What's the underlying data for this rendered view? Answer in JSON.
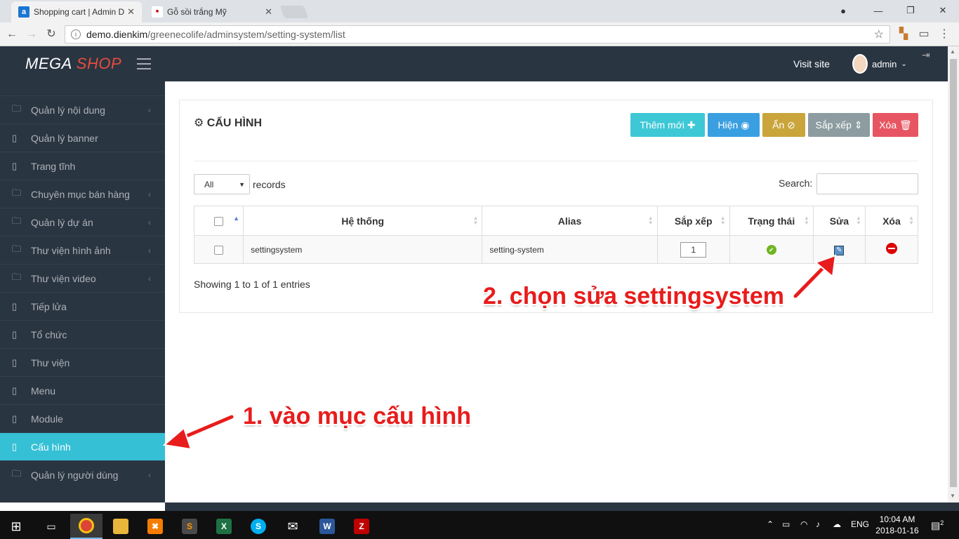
{
  "browser": {
    "tabs": [
      {
        "title": "Shopping cart | Admin D",
        "active": true
      },
      {
        "title": "Gỗ sồi trắng Mỹ",
        "active": false
      }
    ],
    "url_host": "demo.dienkim",
    "url_path": "/greenecolife/adminsystem/setting-system/list"
  },
  "header": {
    "logo_part1": "MEGA",
    "logo_part2": "SHOP",
    "visit_site": "Visit site",
    "user": "admin"
  },
  "sidebar": {
    "items": [
      {
        "label": "Quản lý nội dung",
        "icon": "folder-icon",
        "has_children": true
      },
      {
        "label": "Quản lý banner",
        "icon": "book-icon",
        "has_children": false
      },
      {
        "label": "Trang tĩnh",
        "icon": "book-icon",
        "has_children": false
      },
      {
        "label": "Chuyên mục bán hàng",
        "icon": "folder-icon",
        "has_children": true
      },
      {
        "label": "Quản lý dự án",
        "icon": "folder-icon",
        "has_children": true
      },
      {
        "label": "Thư viện hình ảnh",
        "icon": "folder-icon",
        "has_children": true
      },
      {
        "label": "Thư viện video",
        "icon": "folder-icon",
        "has_children": true
      },
      {
        "label": "Tiếp lửa",
        "icon": "book-icon",
        "has_children": false
      },
      {
        "label": "Tổ chức",
        "icon": "book-icon",
        "has_children": false
      },
      {
        "label": "Thư viện",
        "icon": "book-icon",
        "has_children": false
      },
      {
        "label": "Menu",
        "icon": "book-icon",
        "has_children": false
      },
      {
        "label": "Module",
        "icon": "book-icon",
        "has_children": false
      },
      {
        "label": "Cấu hình",
        "icon": "book-icon",
        "has_children": false,
        "active": true
      },
      {
        "label": "Quản lý người dùng",
        "icon": "folder-icon",
        "has_children": true
      }
    ]
  },
  "panel": {
    "title": "CẤU HÌNH",
    "buttons": {
      "add": "Thêm mới",
      "show": "Hiện",
      "hide": "Ẩn",
      "sort": "Sắp xếp",
      "delete": "Xóa"
    },
    "length_value": "All",
    "length_label": "records",
    "search_label": "Search:",
    "search_value": "",
    "columns": [
      "Hệ thống",
      "Alias",
      "Sắp xếp",
      "Trạng thái",
      "Sửa",
      "Xóa"
    ],
    "rows": [
      {
        "system": "settingsystem",
        "alias": "setting-system",
        "order": "1"
      }
    ],
    "info": "Showing 1 to 1 of 1 entries"
  },
  "annotations": {
    "step1": "1. vào mục cấu hình",
    "step2": "2. chọn sửa settingsystem"
  },
  "taskbar": {
    "time": "10:04 AM",
    "date": "2018-01-16",
    "lang": "ENG",
    "notifications": "2"
  },
  "colors": {
    "sidebar_bg": "#2a3542",
    "accent": "#35c0d5",
    "btn_add": "#3ec8d6",
    "btn_show": "#3a9fe0",
    "btn_hide": "#c9a53b",
    "btn_sort": "#8c9ca0",
    "btn_delete": "#e65561",
    "annotation": "#e81c1c"
  }
}
